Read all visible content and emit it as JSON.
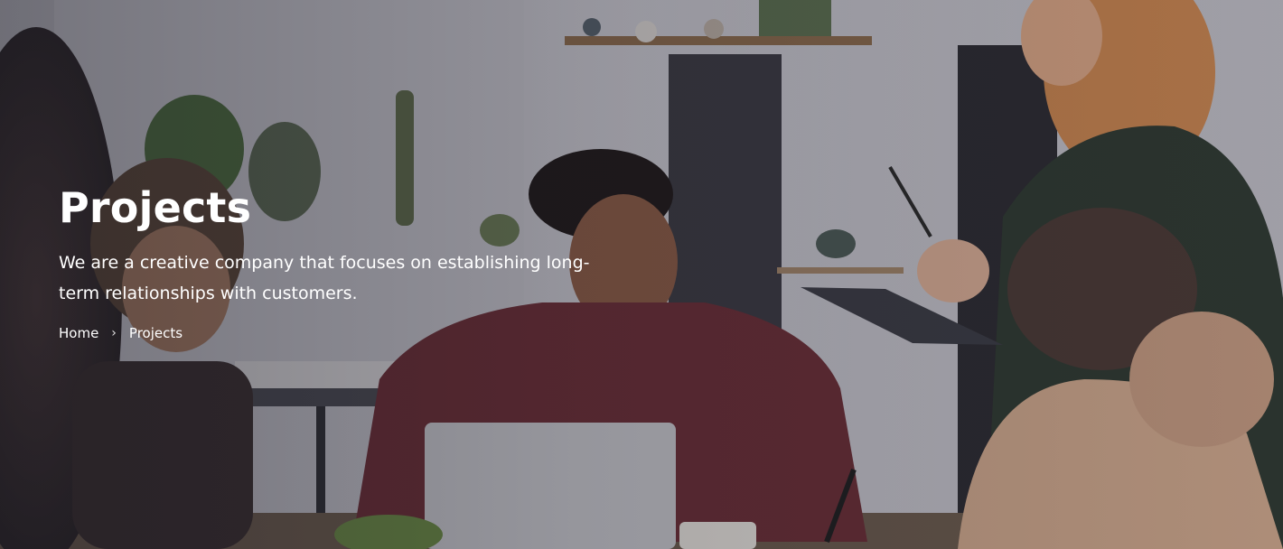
{
  "hero": {
    "title": "Projects",
    "subtitle": "We are a creative company that focuses on establishing long-term relationships with customers.",
    "overlay_color": "#141420"
  },
  "breadcrumb": {
    "items": [
      {
        "label": "Home"
      },
      {
        "label": "Projects"
      }
    ],
    "separator": "›"
  }
}
